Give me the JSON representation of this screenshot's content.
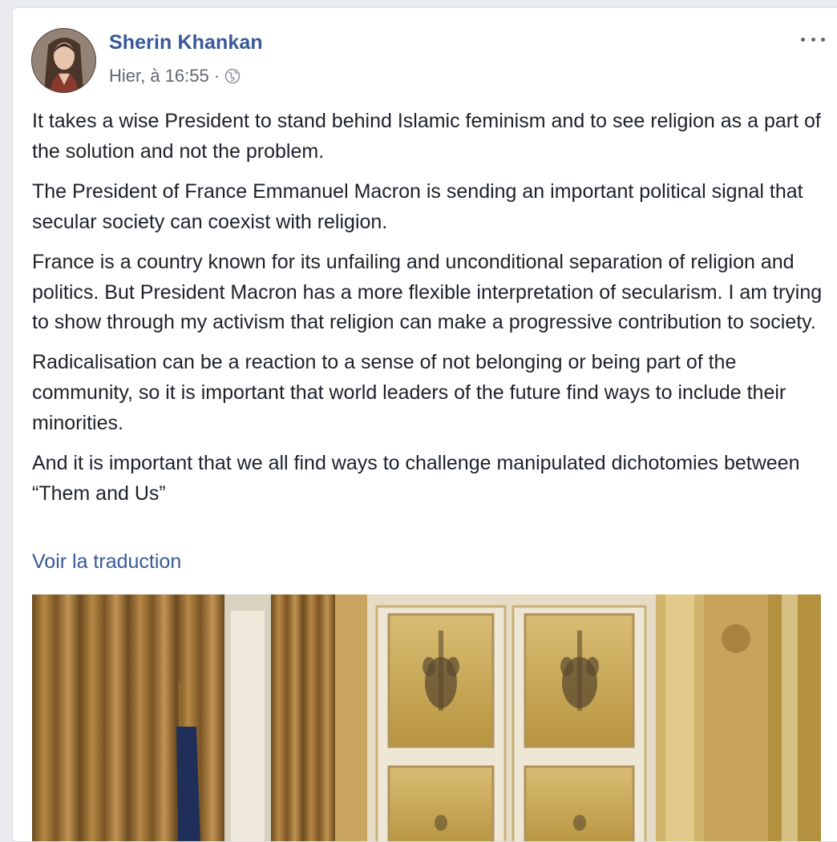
{
  "post": {
    "author": "Sherin Khankan",
    "timestamp": "Hier, à 16:55",
    "separator": "·",
    "audience_icon": "globe-icon",
    "more_icon": "more-options-icon",
    "paragraphs": [
      "It takes a wise President to stand behind Islamic feminism and to see religion as a part of the solution and not the problem.",
      "The President of France Emmanuel Macron is sending an important political signal that secular society can coexist with religion.",
      "France is a country known for its unfailing and unconditional separation of religion and politics. But President Macron has a more flexible interpretation of secularism. I am trying to show through my activism that religion can make a progressive contribution to society.",
      "Radicalisation can be a reaction to a sense of not belonging or being part of the community, so it is important that world leaders of the future find ways to include their minorities.",
      "And it is important that we all find ways to challenge manipulated dichotomies between “Them and Us”"
    ],
    "see_translation": "Voir la traduction"
  },
  "colors": {
    "link_blue": "#385898",
    "text": "#1d2129",
    "meta": "#616770",
    "page_bg": "#e9ebee"
  }
}
